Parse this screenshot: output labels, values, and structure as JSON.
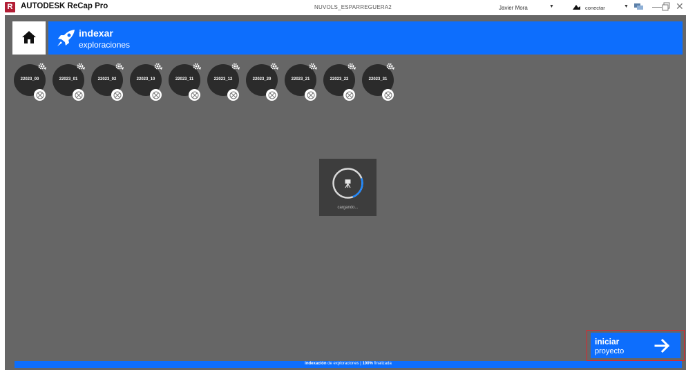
{
  "titlebar": {
    "logo_letter": "R",
    "app_name": "AUTODESK ReCap Pro",
    "document": "NUVOLS_ESPARREGUERA2",
    "user": "Javier Mora",
    "connect_label": "conectar"
  },
  "banner": {
    "title": "indexar",
    "subtitle": "exploraciones"
  },
  "scans": [
    {
      "label": "22023_00"
    },
    {
      "label": "22023_01"
    },
    {
      "label": "22023_02"
    },
    {
      "label": "22023_10"
    },
    {
      "label": "22023_11"
    },
    {
      "label": "22023_12"
    },
    {
      "label": "22023_20"
    },
    {
      "label": "22023_21"
    },
    {
      "label": "22023_22"
    },
    {
      "label": "22023_31"
    }
  ],
  "loader": {
    "label": "cargando...",
    "progress": 0.25
  },
  "start": {
    "line1": "iniciar",
    "line2": "proyecto"
  },
  "status": {
    "part1": "indexación",
    "part2": " de exploraciones | ",
    "part3": "100%",
    "part4": " finalizada"
  },
  "colors": {
    "accent": "#0d6efd",
    "workspace": "#666666",
    "brand": "#b21d35",
    "highlight": "#e0252b"
  }
}
